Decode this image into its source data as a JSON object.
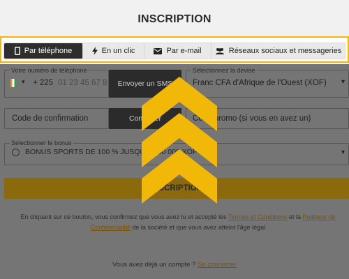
{
  "page": {
    "title": "INSCRIPTION"
  },
  "tabs": [
    {
      "label": "Par téléphone",
      "icon": "mobile-phone-icon",
      "active": true
    },
    {
      "label": "En un clic",
      "icon": "lightning-bolt-icon",
      "active": false
    },
    {
      "label": "Par e-mail",
      "icon": "envelope-icon",
      "active": false
    },
    {
      "label": "Réseaux sociaux et messageries",
      "icon": "users-group-icon",
      "active": false
    }
  ],
  "form": {
    "phone": {
      "label": "Votre numéro de téléphone",
      "prefix": "+ 225",
      "placeholder": "01 23 45 67 8"
    },
    "send_sms": "Envoyer un SMS",
    "currency": {
      "label": "Sélectionnez la devise",
      "value": "Franc CFA d'Afrique de l'Ouest (XOF)"
    },
    "confirmation_code": {
      "placeholder": "Code de confirmation"
    },
    "confirm_button": "Confirmer",
    "promo": {
      "placeholder": "Code promo (si vous en avez un)"
    },
    "bonus": {
      "label": "Sélectionner le bonus",
      "value": "BONUS SPORTS DE 100 % JUSQU'À 500 000 XOF"
    },
    "register_button": "INSCRIPTION"
  },
  "legal": {
    "prefix": "En cliquant sur ce bouton, vous confirmez que vous avez lu et accepté les ",
    "terms_link": "Termes et Conditions",
    "middle": " et la ",
    "policy_link": "Politique de Confidentialité",
    "suffix": " de la société et que vous avez atteint l'âge légal"
  },
  "login": {
    "text": "Vous avez déjà un compte ? ",
    "link": "Se connecter"
  },
  "colors": {
    "accent": "#f2b807",
    "active_tab": "#2e2e2e",
    "overlay": "#757575"
  }
}
